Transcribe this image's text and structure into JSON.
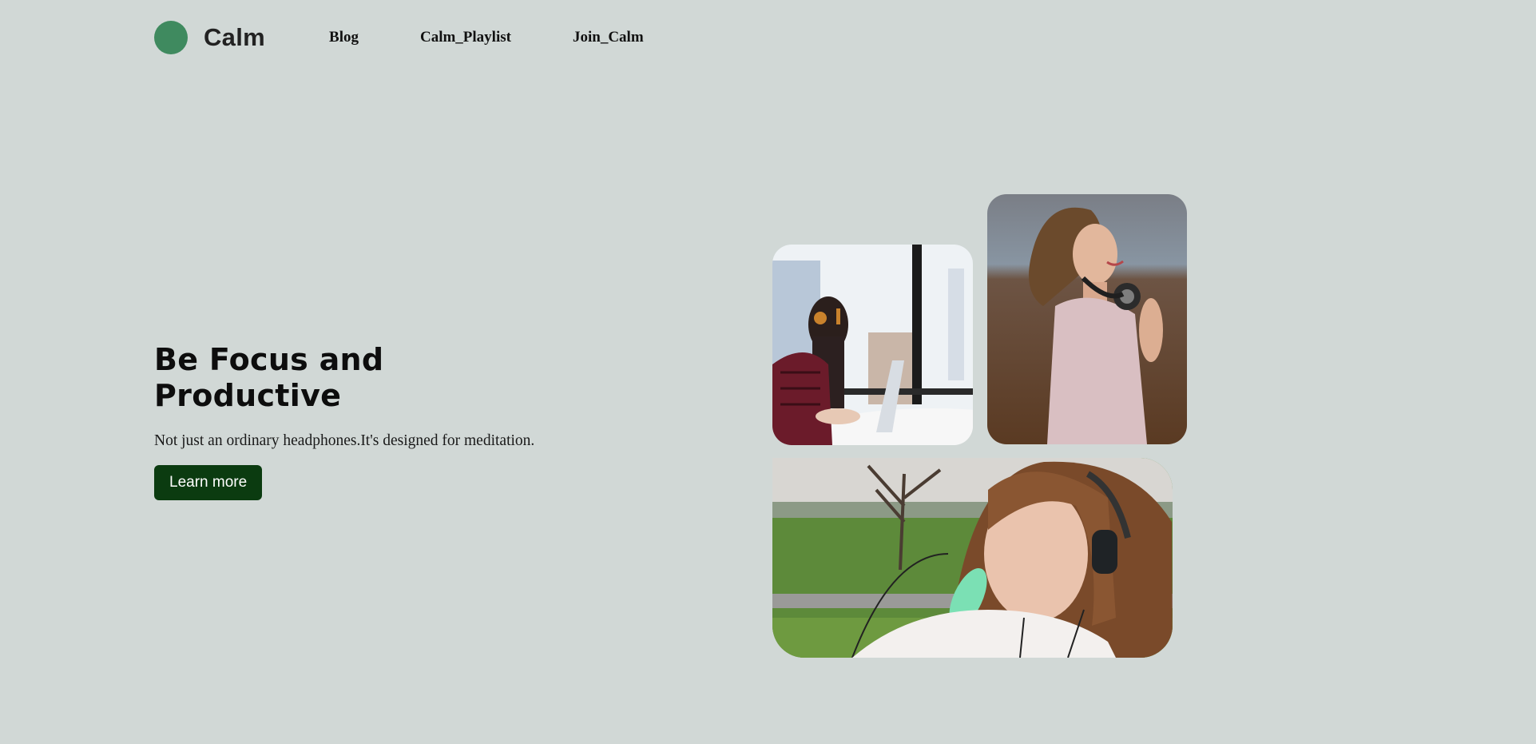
{
  "brand": {
    "name": "Calm",
    "logo_color": "#3f8a5f"
  },
  "nav": {
    "links": [
      {
        "label": "Blog"
      },
      {
        "label": "Calm_Playlist"
      },
      {
        "label": "Join_Calm"
      }
    ]
  },
  "hero": {
    "title": "Be Focus and Productive",
    "subtitle": "Not just an ordinary headphones.It's designed for meditation.",
    "cta_label": "Learn more",
    "cta_color": "#0b3b10"
  },
  "gallery": {
    "images": [
      {
        "subject": "woman-with-headphones-at-laptop-photo"
      },
      {
        "subject": "smiling-woman-with-headphones-photo"
      },
      {
        "subject": "woman-with-headphones-in-park-photo"
      }
    ]
  },
  "colors": {
    "background": "#d1d8d6",
    "text": "#111111"
  }
}
